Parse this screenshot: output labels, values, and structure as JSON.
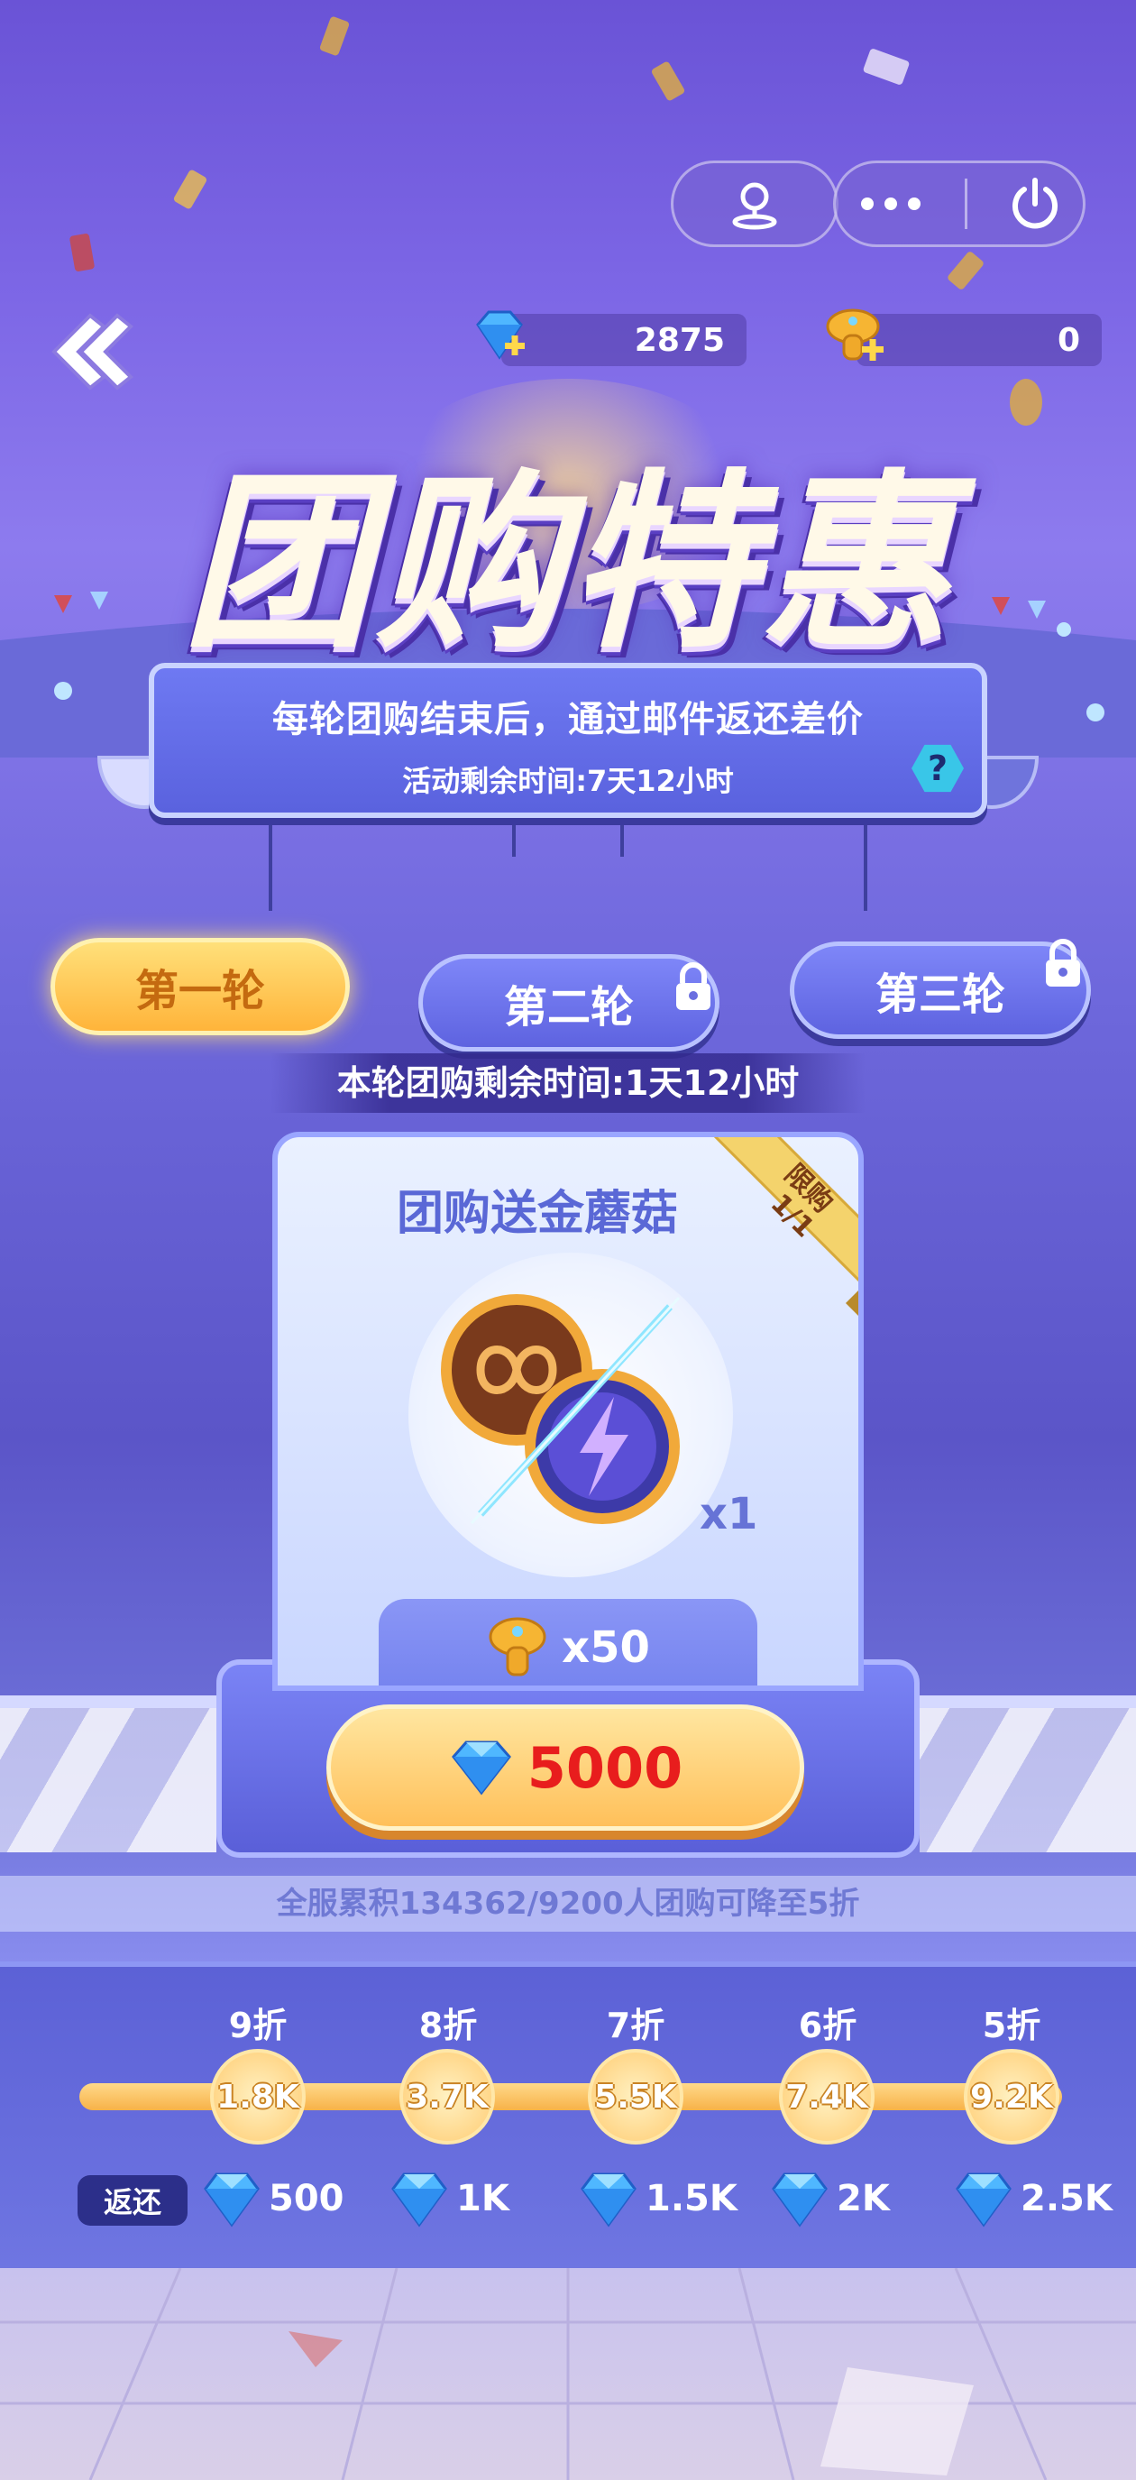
{
  "header": {
    "back_icon": "double-chevron-left-icon",
    "location_icon": "map-pin-icon",
    "more_icon": "more-dots-icon",
    "power_icon": "power-icon"
  },
  "currencies": {
    "gems": "2875",
    "mushrooms": "0"
  },
  "event": {
    "title": "团购特惠",
    "info_line1": "每轮团购结束后，通过邮件返还差价",
    "info_line2": "活动剩余时间:7天12小时",
    "help": "?"
  },
  "tabs": [
    {
      "label": "第一轮",
      "active": true,
      "locked": false
    },
    {
      "label": "第二轮",
      "active": false,
      "locked": true
    },
    {
      "label": "第三轮",
      "active": false,
      "locked": true
    }
  ],
  "round_timer": "本轮团购剩余时间:1天12小时",
  "offer": {
    "title": "团购送金蘑菇",
    "limit_label": "限购",
    "limit_value": "1/1",
    "item_qty": "x1",
    "reward_qty": "x50",
    "price": "5000"
  },
  "server_note": "全服累积134362/9200人团购可降至5折",
  "tiers": {
    "return_label": "返还",
    "items": [
      {
        "discount": "9折",
        "threshold": "1.8K",
        "refund": "500"
      },
      {
        "discount": "8折",
        "threshold": "3.7K",
        "refund": "1K"
      },
      {
        "discount": "7折",
        "threshold": "5.5K",
        "refund": "1.5K"
      },
      {
        "discount": "6折",
        "threshold": "7.4K",
        "refund": "2K"
      },
      {
        "discount": "5折",
        "threshold": "9.2K",
        "refund": "2.5K"
      }
    ]
  },
  "colors": {
    "accent_gold": "#ffc05a",
    "price_red": "#e81d1d",
    "panel_blue": "#5a62de"
  }
}
